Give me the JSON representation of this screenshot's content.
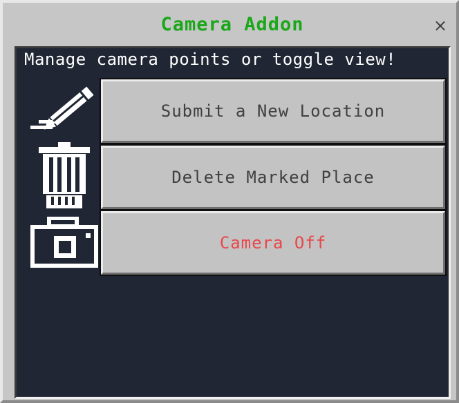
{
  "window": {
    "title": "Camera Addon",
    "close_symbol": "×",
    "title_color": "#1aa81a"
  },
  "body_text": "Manage camera points or toggle view!",
  "buttons": [
    {
      "label": "Submit a New Location",
      "icon": "pencil-icon",
      "text_color": "#404040"
    },
    {
      "label": "Delete Marked Place",
      "icon": "trash-can-icon",
      "text_color": "#404040"
    },
    {
      "label": "Camera Off",
      "icon": "camera-icon",
      "text_color": "#e8474a"
    }
  ]
}
